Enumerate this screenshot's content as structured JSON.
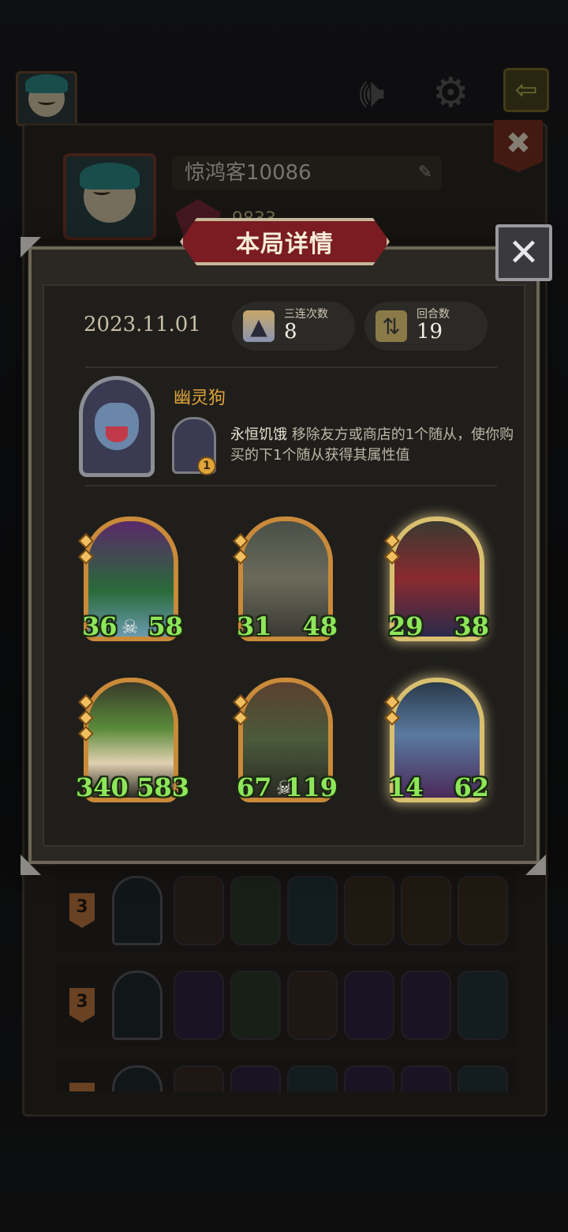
{
  "background": {
    "player_name": "惊鸿客10086",
    "rank_points": "9833",
    "history_rows": [
      {
        "rank": "3"
      },
      {
        "rank": "3"
      },
      {
        "rank": ""
      }
    ]
  },
  "dialog": {
    "title": "本局详情",
    "date": "2023.11.01",
    "stats": {
      "triples_label": "三连次数",
      "triples_value": "8",
      "turns_label": "回合数",
      "turns_value": "19"
    },
    "hero": {
      "name": "幽灵狗",
      "power_level": "1",
      "power_name": "永恒饥饿",
      "power_text": "移除友方或商店的1个随从，使你购买的下1个随从获得其属性值"
    },
    "minions": [
      {
        "attack": "36",
        "health": "58",
        "golden": false,
        "skull": true
      },
      {
        "attack": "31",
        "health": "48",
        "golden": false,
        "skull": false
      },
      {
        "attack": "29",
        "health": "38",
        "golden": true,
        "skull": false
      },
      {
        "attack": "340",
        "health": "583",
        "golden": false,
        "skull": false
      },
      {
        "attack": "67",
        "health": "119",
        "golden": false,
        "skull": true
      },
      {
        "attack": "14",
        "health": "62",
        "golden": true,
        "skull": false
      }
    ]
  },
  "colors": {
    "title_banner": "#7a1c22",
    "stat_green": "#8ee65a",
    "card_border": "#c98a3a",
    "golden_border": "#d8c070",
    "hero_name": "#e0a43a"
  },
  "icons": {
    "top_bar": [
      "speaker-icon",
      "gear-icon",
      "exit-icon"
    ],
    "close": "close-icon",
    "edit": "pencil-icon",
    "skull": "skull-icon"
  }
}
